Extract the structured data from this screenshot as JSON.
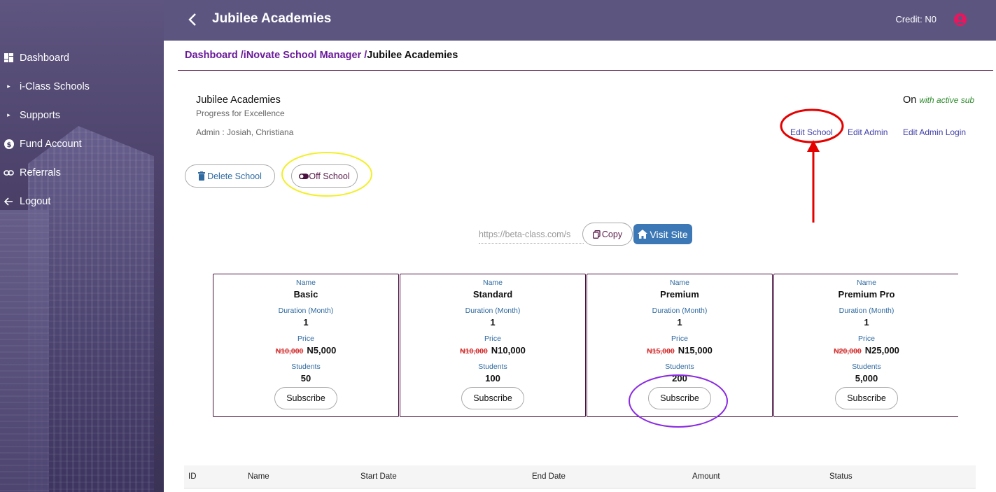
{
  "sidebar": {
    "items": [
      {
        "label": "Dashboard",
        "icon": "dashboard-icon"
      },
      {
        "label": "i-Class Schools",
        "icon": "caret-right-icon"
      },
      {
        "label": "Supports",
        "icon": "caret-right-icon"
      },
      {
        "label": "Fund Account",
        "icon": "dollar-icon"
      },
      {
        "label": "Referrals",
        "icon": "link-icon"
      },
      {
        "label": "Logout",
        "icon": "arrow-left-icon"
      }
    ]
  },
  "header": {
    "title": "Jubilee Academies",
    "credit": "Credit: N0"
  },
  "breadcrumb": {
    "dashboard": "Dashboard /",
    "manager": "iNovate School Manager /",
    "current": "Jubilee Academies"
  },
  "school": {
    "name": "Jubilee Academies",
    "motto": "Progress for Excellence",
    "admin": "Admin : Josiah, Christiana",
    "status": "On",
    "status_note": "with active sub"
  },
  "actions": {
    "edit_school": "Edit School",
    "edit_admin": "Edit Admin",
    "edit_admin_login": "Edit Admin Login",
    "delete_school": "Delete School",
    "off_school": "Off School"
  },
  "site": {
    "url": "https://beta-class.com/s",
    "copy": "Copy",
    "visit": "Visit Site"
  },
  "plan_labels": {
    "name": "Name",
    "duration": "Duration (Month)",
    "price": "Price",
    "students": "Students",
    "subscribe": "Subscribe"
  },
  "plans": [
    {
      "name": "Basic",
      "duration": "1",
      "old_price": "N10,000",
      "price": "N5,000",
      "students": "50"
    },
    {
      "name": "Standard",
      "duration": "1",
      "old_price": "N10,000",
      "price": "N10,000",
      "students": "100"
    },
    {
      "name": "Premium",
      "duration": "1",
      "old_price": "N15,000",
      "price": "N15,000",
      "students": "200"
    },
    {
      "name": "Premium Pro",
      "duration": "1",
      "old_price": "N20,000",
      "price": "N25,000",
      "students": "5,000"
    }
  ],
  "table": {
    "columns": [
      "ID",
      "Name",
      "Start Date",
      "End Date",
      "Amount",
      "Status"
    ]
  },
  "colors": {
    "header_bg": "#5c5580",
    "brand_purple": "#6a1b9a",
    "annotation_red": "#e50000",
    "annotation_yellow": "#f2ef2a",
    "annotation_violet": "#8a2be2"
  }
}
